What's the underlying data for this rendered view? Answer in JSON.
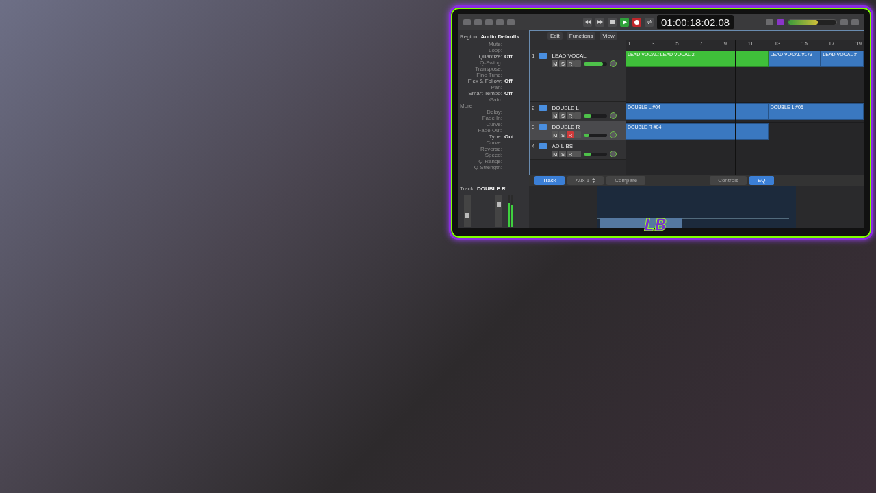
{
  "transport": {
    "buttons": [
      {
        "kind": "rewind",
        "on": false
      },
      {
        "kind": "forward",
        "on": false
      },
      {
        "kind": "stop",
        "on": false
      },
      {
        "kind": "play",
        "on": true
      },
      {
        "kind": "record",
        "on": true
      },
      {
        "kind": "cycle",
        "on": false
      }
    ],
    "time": "01:00:18:02.08",
    "master_volume": {
      "level": 0.62
    }
  },
  "inspector": {
    "title_label": "Region:",
    "title_value": "Audio Defaults",
    "rows": [
      {
        "label": "Mute:",
        "value": ""
      },
      {
        "label": "Loop:",
        "value": ""
      },
      {
        "label": "Quantize:",
        "value": "Off"
      },
      {
        "label": "Q-Swing:",
        "value": ""
      },
      {
        "label": "Transpose:",
        "value": ""
      },
      {
        "label": "Fine Tune:",
        "value": ""
      },
      {
        "label": "Flex & Follow:",
        "value": "Off"
      },
      {
        "label": "Pan:",
        "value": ""
      },
      {
        "label": "Smart Tempo:",
        "value": "Off"
      },
      {
        "label": "Gain:",
        "value": ""
      },
      {
        "label": "More",
        "value": "",
        "kind": "section"
      },
      {
        "label": "Delay:",
        "value": ""
      },
      {
        "label": "Fade In:",
        "value": ""
      },
      {
        "label": "Curve:",
        "value": ""
      },
      {
        "label": "Fade Out:",
        "value": ""
      },
      {
        "label": "Type:",
        "value": "Out"
      },
      {
        "label": "Curve:",
        "value": ""
      },
      {
        "label": "Reverse:",
        "value": ""
      },
      {
        "label": "Speed:",
        "value": ""
      },
      {
        "label": "Q-Range:",
        "value": ""
      },
      {
        "label": "Q-Strength:",
        "value": ""
      }
    ],
    "track_label": "Track:",
    "track_value": "DOUBLE R"
  },
  "menu": [
    "Edit",
    "Functions",
    "View"
  ],
  "ruler": [
    "1",
    "3",
    "5",
    "7",
    "9",
    "11",
    "13",
    "15",
    "17",
    "19"
  ],
  "tracks": [
    {
      "number": "1",
      "name": "LEAD VOCAL",
      "selected": false,
      "record": false,
      "level": 0.82,
      "buttons": [
        "M",
        "S",
        "R",
        "I"
      ],
      "regions": [
        {
          "name": "LEAD VOCAL: LEAD VOCAL.2",
          "color": "#3fbf3a"
        },
        {
          "name": "LEAD VOCAL #173",
          "color": "#3a78c0"
        },
        {
          "name": "LEAD VOCAL #",
          "color": "#3a78c0"
        }
      ]
    },
    {
      "number": "2",
      "name": "DOUBLE L",
      "selected": false,
      "record": false,
      "level": 0.3,
      "buttons": [
        "M",
        "S",
        "R",
        "I"
      ],
      "regions": [
        {
          "name": "DOUBLE L #04",
          "color": "#3a78c0"
        },
        {
          "name": "DOUBLE L #05",
          "color": "#3a78c0"
        }
      ]
    },
    {
      "number": "3",
      "name": "DOUBLE R",
      "selected": true,
      "record": true,
      "level": 0.22,
      "buttons": [
        "M",
        "S",
        "R",
        "I"
      ],
      "regions": [
        {
          "name": "DOUBLE R #04",
          "color": "#3a78c0"
        }
      ]
    },
    {
      "number": "4",
      "name": "AD LIBS",
      "selected": false,
      "record": false,
      "level": 0.3,
      "buttons": [
        "M",
        "S",
        "R",
        "I"
      ]
    }
  ],
  "bottom": {
    "tabs": [
      {
        "label": "Track",
        "selected": true
      },
      {
        "label": "Aux 1",
        "selected": false,
        "kind": "dropdown"
      },
      {
        "label": "Compare",
        "selected": false
      }
    ],
    "view_tabs": [
      {
        "label": "Controls",
        "selected": false
      },
      {
        "label": "EQ",
        "selected": true
      }
    ]
  },
  "logo": "LB"
}
